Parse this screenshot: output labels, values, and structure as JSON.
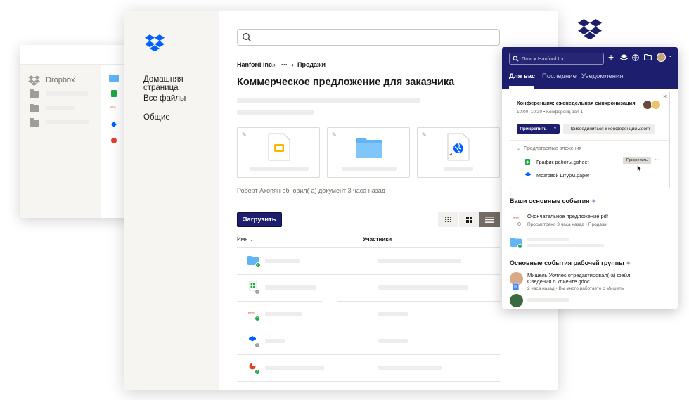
{
  "back_window": {
    "app_name": "Dropbox"
  },
  "main": {
    "nav": [
      "Домашняя страница",
      "Все файлы",
      "Общие"
    ],
    "breadcrumb": {
      "root": "Hanford Inc.",
      "sep1": "›",
      "ellipsis": "···",
      "sep2": "›",
      "current": "Продажи"
    },
    "title": "Коммерческое предложение для заказчика",
    "activity": "Роберт Акопян обновил(-а) документ 3 часа назад",
    "upload_label": "Загрузить",
    "columns": {
      "name": "Имя",
      "members": "Участники"
    },
    "pdf_label": "PDF"
  },
  "popup": {
    "search_placeholder": "Поиск Hanford Inc.",
    "tabs": [
      "Для вас",
      "Последние",
      "Уведомления"
    ],
    "meeting": {
      "title": "Конференция: еженедельная синхронизация",
      "time": "10:00–10:30 • Конференц зал 1",
      "pin_label": "Прикрепить",
      "zoom_label": "Присоединиться к конференции Zoom",
      "suggested_header": "Предлагаемые вложения",
      "attachments": [
        {
          "name": "График работы.gsheet",
          "action": "Прикрепить"
        },
        {
          "name": "Мозговой штурм.paper"
        }
      ]
    },
    "highlights_title": "Ваши основные события",
    "highlight_file": "Окончательное предложение.pdf",
    "highlight_meta": "Просмотрено 3 часа назад • Продажи",
    "team_title": "Основные события рабочей группы",
    "team_event_line1": "Мишель Уоллес отредактировал(-а) файл",
    "team_event_line2": "Сведения о клиенте.gdoc",
    "team_event_meta": "2 часа назад • Вы много работаете с Мишель",
    "close": "×",
    "chevron": "⌄",
    "plus": "+"
  },
  "colors": {
    "brand_blue": "#0061fe",
    "navy": "#1e1e6e",
    "folder_blue": "#61b5f6",
    "success_green": "#1fa846"
  }
}
